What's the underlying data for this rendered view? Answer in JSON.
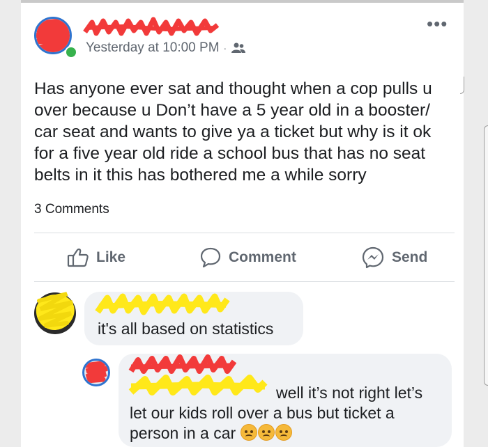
{
  "post": {
    "timestamp": "Yesterday at 10:00 PM",
    "separator": "·",
    "audience_icon": "friends-icon",
    "more_label": "•••",
    "text": "Has anyone ever sat and thought when a cop pulls u over because u Don’t have a 5 year old in a booster/ car seat and wants to give ya a ticket but why is it ok for a five year old ride a school bus that has no seat belts in it this has bothered me a while sorry",
    "comments_count": "3 Comments"
  },
  "actions": {
    "like_label": "Like",
    "comment_label": "Comment",
    "send_label": "Send"
  },
  "comments": [
    {
      "text": "it's all based on statistics"
    },
    {
      "line1": "well it’s not right let’s",
      "line2": "let our kids roll over a bus but ticket a",
      "line3": "person in a car",
      "emoji_icon": "angry-face-icon"
    }
  ],
  "colors": {
    "redaction_red": "#f23a3a",
    "redaction_yellow": "#ffe81a",
    "avatar_ring": "#2f74cf",
    "online": "#37b24d",
    "icon_gray": "#606770",
    "bubble": "#f0f2f5"
  }
}
